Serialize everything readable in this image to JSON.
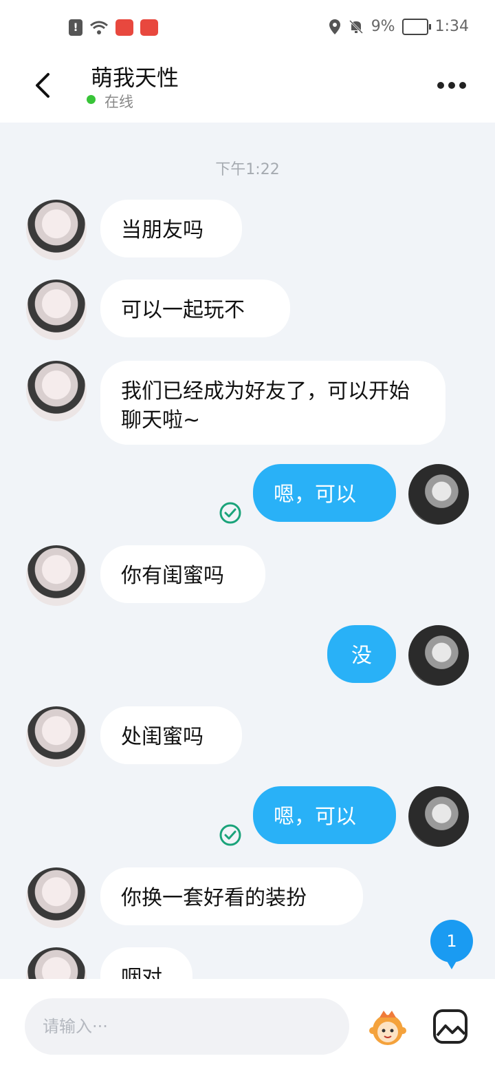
{
  "status_bar": {
    "alert_glyph": "!",
    "battery": "9%",
    "time": "1:34",
    "icons": [
      "alert-icon",
      "wifi-icon",
      "app-icon",
      "app-icon",
      "location-icon",
      "mute-bell-icon",
      "battery-icon"
    ]
  },
  "header": {
    "title": "萌我天性",
    "status": "在线",
    "status_color": "#38c438"
  },
  "chat": {
    "timestamp": "下午1:22",
    "messages": [
      {
        "from": "other",
        "text": "当朋友吗"
      },
      {
        "from": "other",
        "text": "可以一起玩不"
      },
      {
        "from": "other",
        "text": "我们已经成为好友了，可以开始聊天啦~"
      },
      {
        "from": "me",
        "text": "嗯，可以",
        "read": true
      },
      {
        "from": "other",
        "text": "你有闺蜜吗"
      },
      {
        "from": "me",
        "text": "没",
        "read": false
      },
      {
        "from": "other",
        "text": "处闺蜜吗"
      },
      {
        "from": "me",
        "text": "嗯，可以",
        "read": true
      },
      {
        "from": "other",
        "text": "你换一套好看的装扮"
      },
      {
        "from": "other",
        "text": "咽对"
      }
    ],
    "unread_count": "1"
  },
  "input_bar": {
    "placeholder": "请输入···",
    "value": ""
  },
  "colors": {
    "my_bubble": "#29b1f7",
    "background": "#f1f4f8",
    "read_check": "#1aa37a"
  }
}
